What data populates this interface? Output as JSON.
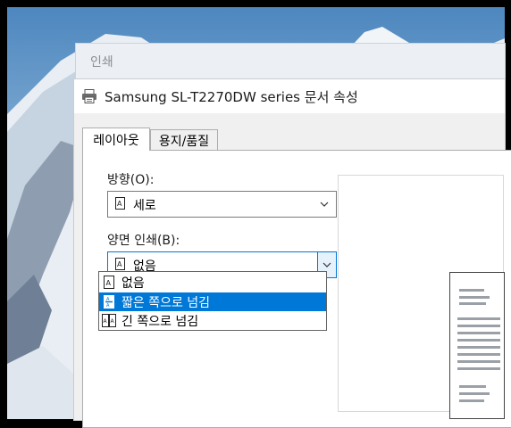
{
  "print_window": {
    "title": "인쇄"
  },
  "dialog": {
    "title": "Samsung SL-T2270DW series 문서 속성",
    "tabs": [
      {
        "label": "레이아웃"
      },
      {
        "label": "용지/품질"
      }
    ],
    "orientation": {
      "label": "방향(O):",
      "value": "세로"
    },
    "duplex": {
      "label": "양면 인쇄(B):",
      "value": "없음",
      "options": [
        {
          "label": "없음",
          "selected": false
        },
        {
          "label": "짧은 쪽으로 넘김",
          "selected": true
        },
        {
          "label": "긴 쪽으로 넘김",
          "selected": false
        }
      ]
    }
  },
  "colors": {
    "accent": "#0078d7",
    "dialog_bg": "#f0f0f0"
  },
  "icons": [
    "printer-icon",
    "portrait-page-icon",
    "chevron-down-icon",
    "duplex-short-edge-icon",
    "duplex-long-edge-icon"
  ]
}
